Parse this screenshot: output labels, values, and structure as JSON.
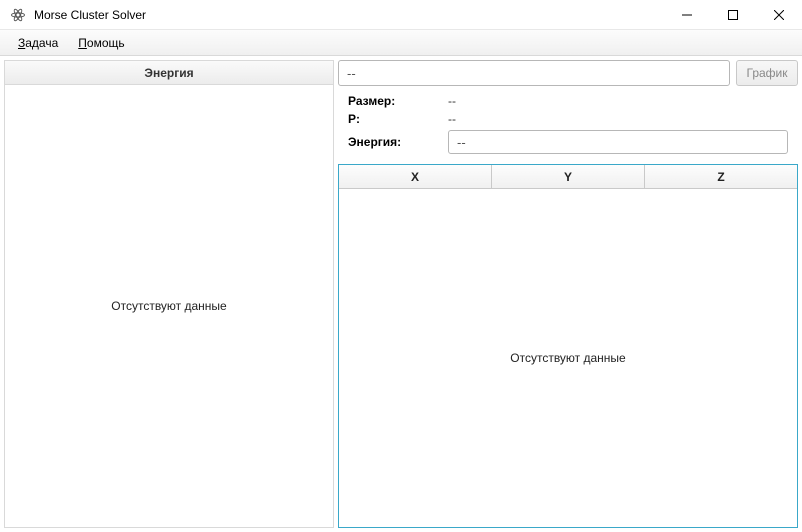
{
  "window": {
    "title": "Morse Cluster Solver"
  },
  "menu": {
    "task": "Задача",
    "help": "Помощь"
  },
  "left": {
    "header": "Энергия",
    "empty": "Отсутствуют данные"
  },
  "right": {
    "name_value": "--",
    "graph_btn": "График",
    "labels": {
      "size": "Размер:",
      "p": "P:",
      "energy": "Энергия:"
    },
    "values": {
      "size": "--",
      "p": "--",
      "energy": "--"
    },
    "grid": {
      "cols": {
        "x": "X",
        "y": "Y",
        "z": "Z"
      },
      "empty": "Отсутствуют данные"
    }
  }
}
